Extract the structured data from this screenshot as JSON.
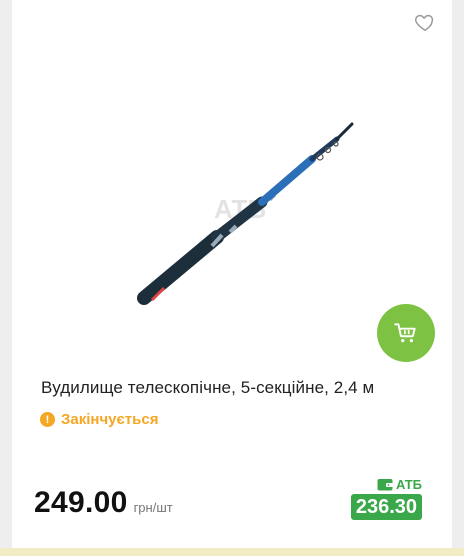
{
  "product": {
    "title": "Вудилище телескопічне, 5-секційне, 2,4 м",
    "image_icon": "fishing-rod-image",
    "watermark": "АТБ"
  },
  "status": {
    "text": "Закінчується",
    "icon": "warning-icon",
    "color": "#f5a623"
  },
  "price": {
    "value": "249.00",
    "unit": "грн/шт"
  },
  "atb_offer": {
    "label": "АТБ",
    "icon": "wallet-icon",
    "price": "236.30",
    "color": "#3aa84a"
  },
  "actions": {
    "cart_icon": "cart-icon",
    "wishlist_icon": "heart-icon",
    "cart_color": "#7ec244"
  }
}
